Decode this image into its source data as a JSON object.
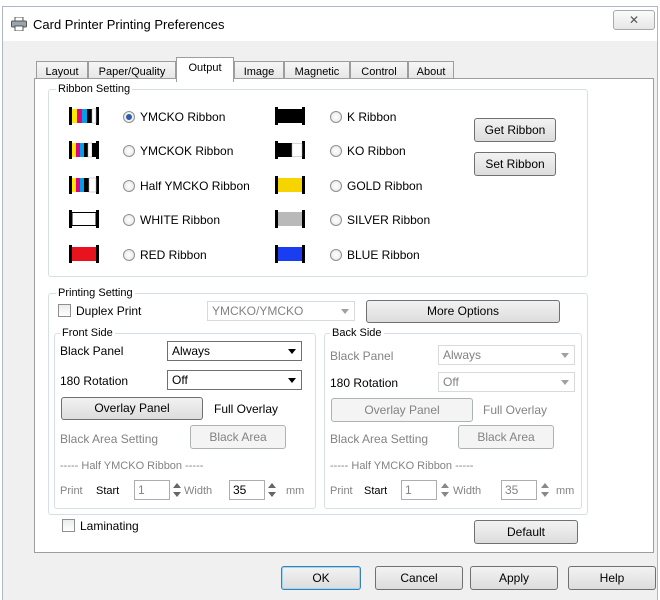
{
  "window": {
    "title": "Card Printer Printing Preferences",
    "close_symbol": "✕"
  },
  "tabs": [
    {
      "label": "Layout"
    },
    {
      "label": "Paper/Quality"
    },
    {
      "label": "Output",
      "active": true
    },
    {
      "label": "Image"
    },
    {
      "label": "Magnetic"
    },
    {
      "label": "Control"
    },
    {
      "label": "About"
    }
  ],
  "ribbon_setting": {
    "label": "Ribbon Setting",
    "selected": "YMCKO Ribbon",
    "left_options": [
      {
        "label": "YMCKO Ribbon",
        "icon": "ymcko-ribbon-icon"
      },
      {
        "label": "YMCKOK Ribbon",
        "icon": "ymckok-ribbon-icon"
      },
      {
        "label": "Half YMCKO Ribbon",
        "icon": "half-ymcko-ribbon-icon"
      },
      {
        "label": "WHITE Ribbon",
        "icon": "white-ribbon-icon"
      },
      {
        "label": "RED Ribbon",
        "icon": "red-ribbon-icon"
      }
    ],
    "right_options": [
      {
        "label": "K Ribbon",
        "icon": "k-ribbon-icon"
      },
      {
        "label": "KO Ribbon",
        "icon": "ko-ribbon-icon"
      },
      {
        "label": "GOLD Ribbon",
        "icon": "gold-ribbon-icon"
      },
      {
        "label": "SILVER Ribbon",
        "icon": "silver-ribbon-icon"
      },
      {
        "label": "BLUE Ribbon",
        "icon": "blue-ribbon-icon"
      }
    ],
    "get_button": "Get Ribbon",
    "set_button": "Set Ribbon"
  },
  "printing_setting": {
    "label": "Printing Setting",
    "duplex_label": "Duplex Print",
    "duplex_checked": false,
    "mode_combo": "YMCKO/YMCKO",
    "more_options": "More Options",
    "front": {
      "label": "Front Side",
      "black_panel_label": "Black Panel",
      "black_panel_value": "Always",
      "rotation_label": "180 Rotation",
      "rotation_value": "Off",
      "overlay_button": "Overlay Panel",
      "overlay_value": "Full Overlay",
      "black_area_label": "Black Area Setting",
      "black_area_button": "Black Area",
      "half_label": "----- Half YMCKO Ribbon -----",
      "print_label": "Print",
      "start_label": "Start",
      "start_value": "1",
      "width_label": "Width",
      "width_value": "35",
      "unit": "mm"
    },
    "back": {
      "label": "Back Side",
      "black_panel_label": "Black Panel",
      "black_panel_value": "Always",
      "rotation_label": "180 Rotation",
      "rotation_value": "Off",
      "overlay_button": "Overlay Panel",
      "overlay_value": "Full Overlay",
      "black_area_label": "Black Area Setting",
      "black_area_button": "Black Area",
      "half_label": "----- Half YMCKO Ribbon -----",
      "print_label": "Print",
      "start_label": "Start",
      "start_value": "1",
      "width_label": "Width",
      "width_value": "35",
      "unit": "mm"
    }
  },
  "laminating": {
    "label": "Laminating",
    "checked": false
  },
  "default_button": "Default",
  "footer": {
    "ok": "OK",
    "cancel": "Cancel",
    "apply": "Apply",
    "help": "Help"
  },
  "colors": {
    "selected_radio": "#2b5fab",
    "disabled_text": "#838383",
    "gold": "#f5d400",
    "silver": "#b9b9b9",
    "red": "#e8131f",
    "blue": "#1a3df2"
  }
}
